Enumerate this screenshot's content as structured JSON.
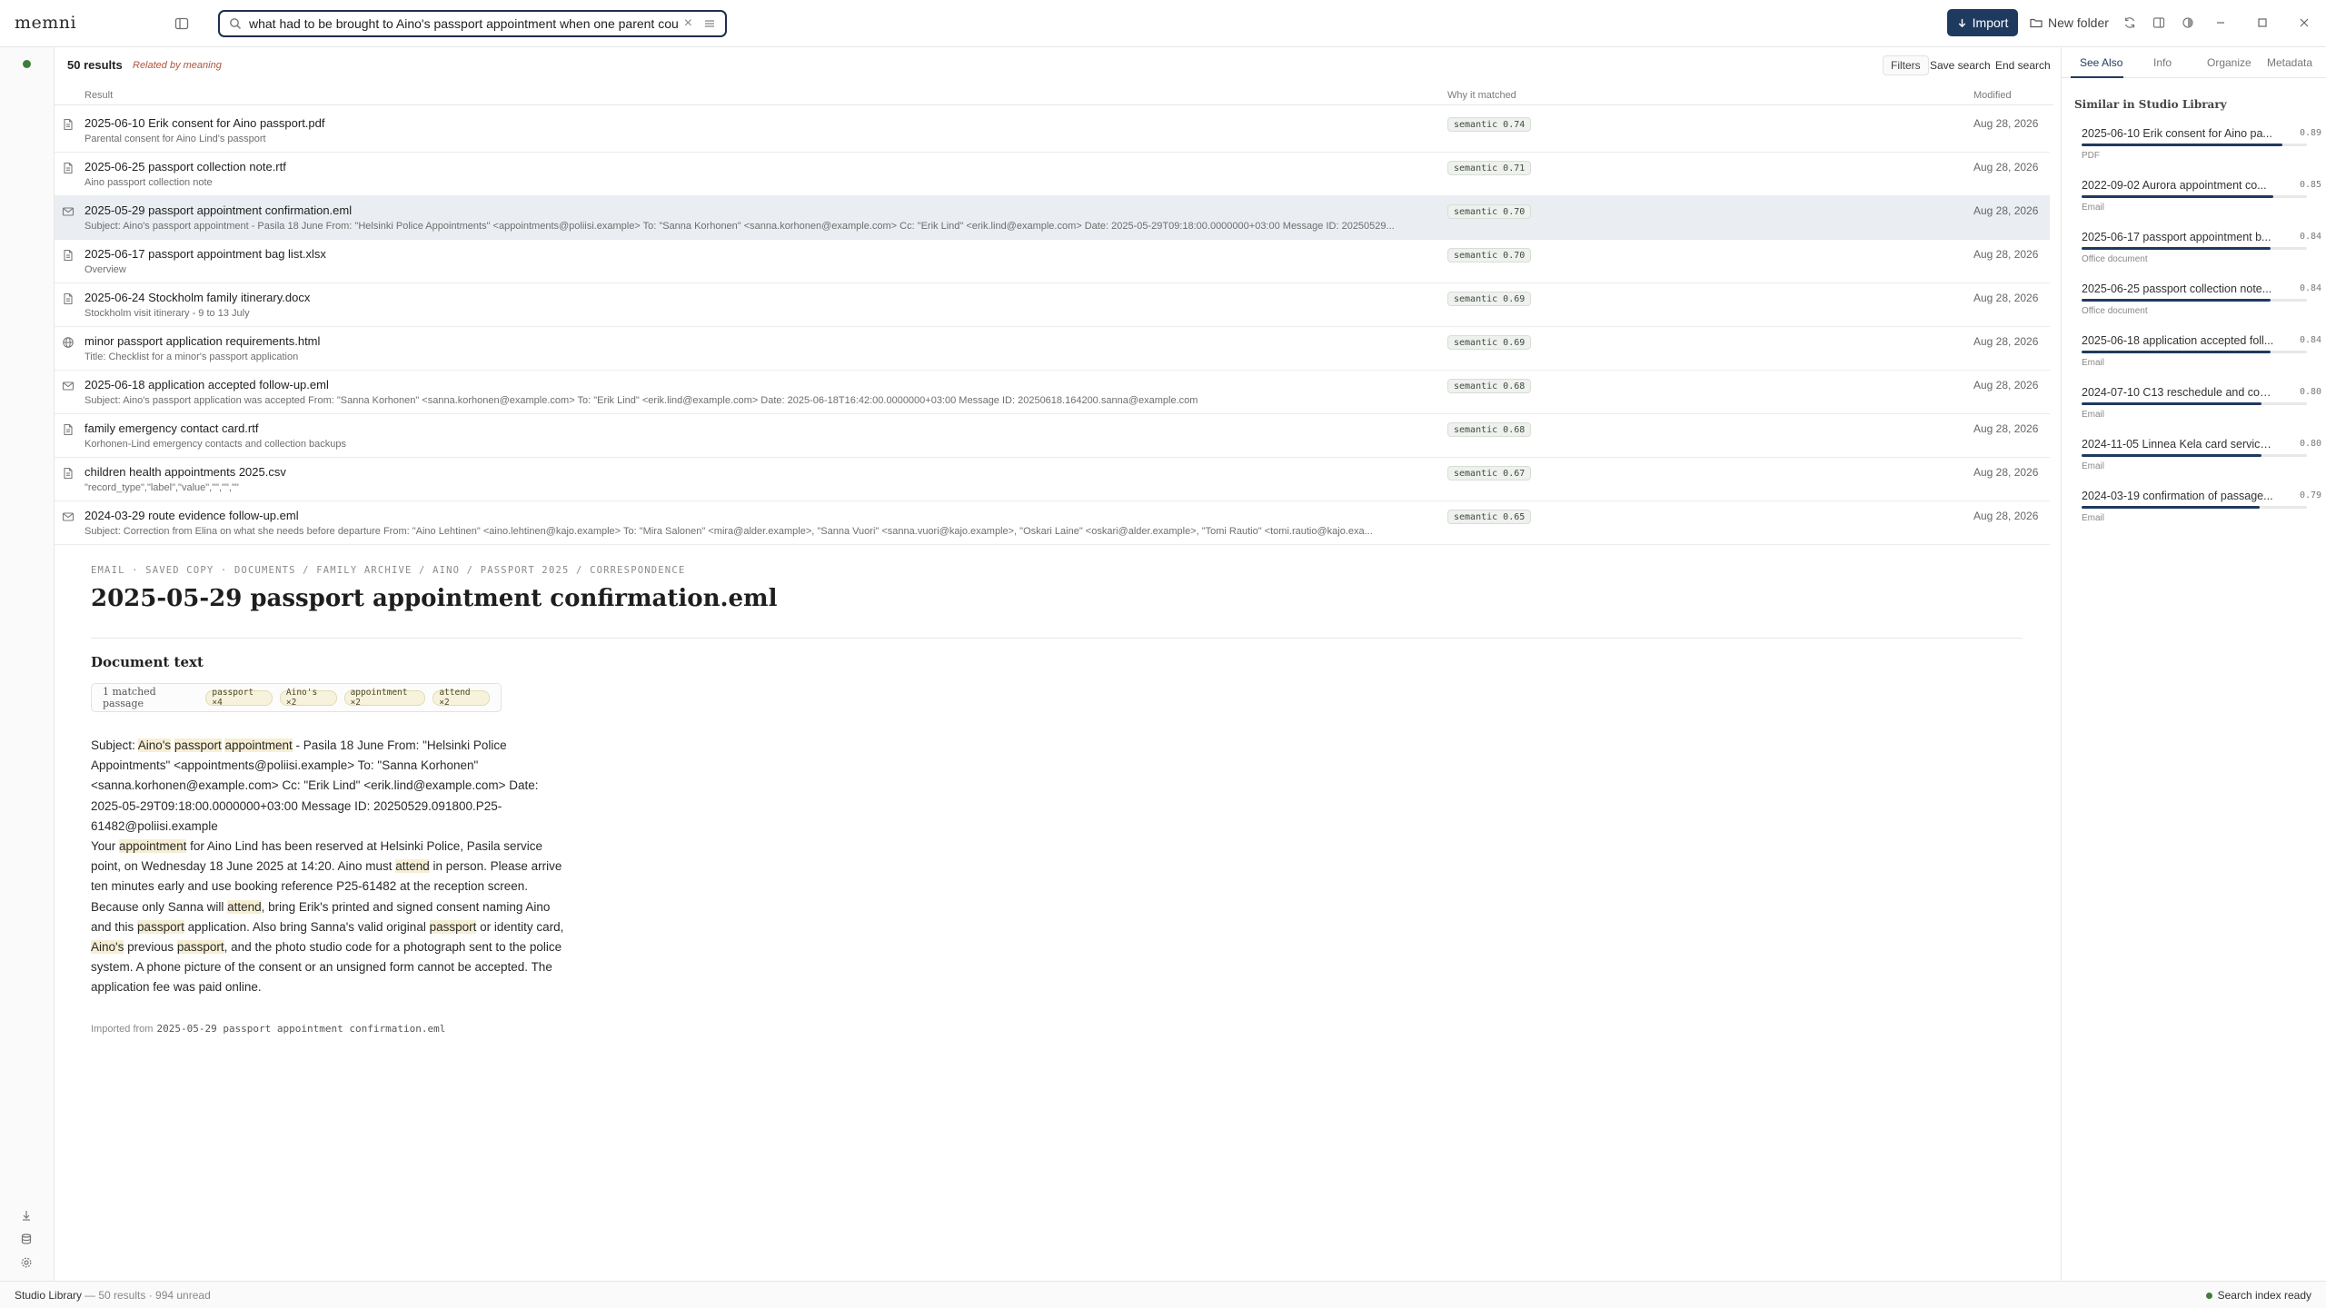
{
  "app": {
    "name": "memni"
  },
  "search": {
    "query": "what had to be brought to Aino's passport appointment when one parent could not attend",
    "placeholder": ""
  },
  "toolbar": {
    "import_label": "Import",
    "new_folder_label": "New folder"
  },
  "results": {
    "count_label": "50 results",
    "related_label": "Related by meaning",
    "filters_label": "Filters",
    "save_search_label": "Save search",
    "end_search_label": "End search",
    "columns": {
      "result": "Result",
      "why": "Why it matched",
      "modified": "Modified"
    },
    "rows": [
      {
        "icon": "document-icon",
        "title": "2025-06-10 Erik consent for Aino passport.pdf",
        "sub": "Parental consent for Aino Lind's passport",
        "badge": "semantic 0.74",
        "modified": "Aug 28, 2026"
      },
      {
        "icon": "document-icon",
        "title": "2025-06-25 passport collection note.rtf",
        "sub": "Aino passport collection note",
        "badge": "semantic 0.71",
        "modified": "Aug 28, 2026"
      },
      {
        "icon": "email-icon",
        "title": "2025-05-29 passport appointment confirmation.eml",
        "sub": "Subject: Aino's passport appointment - Pasila 18 June From: \"Helsinki Police Appointments\" <appointments@poliisi.example> To: \"Sanna Korhonen\" <sanna.korhonen@example.com> Cc: \"Erik Lind\" <erik.lind@example.com> Date: 2025-05-29T09:18:00.0000000+03:00 Message ID: 20250529...",
        "badge": "semantic 0.70",
        "modified": "Aug 28, 2026",
        "selected": true
      },
      {
        "icon": "document-icon",
        "title": "2025-06-17 passport appointment bag list.xlsx",
        "sub": "Overview",
        "badge": "semantic 0.70",
        "modified": "Aug 28, 2026"
      },
      {
        "icon": "document-icon",
        "title": "2025-06-24 Stockholm family itinerary.docx",
        "sub": "Stockholm visit itinerary - 9 to 13 July",
        "badge": "semantic 0.69",
        "modified": "Aug 28, 2026"
      },
      {
        "icon": "globe-icon",
        "title": "minor passport application requirements.html",
        "sub": "Title: Checklist for a minor's passport application",
        "badge": "semantic 0.69",
        "modified": "Aug 28, 2026"
      },
      {
        "icon": "email-icon",
        "title": "2025-06-18 application accepted follow-up.eml",
        "sub": "Subject: Aino's passport application was accepted From: \"Sanna Korhonen\" <sanna.korhonen@example.com> To: \"Erik Lind\" <erik.lind@example.com> Date: 2025-06-18T16:42:00.0000000+03:00 Message ID: 20250618.164200.sanna@example.com",
        "badge": "semantic 0.68",
        "modified": "Aug 28, 2026"
      },
      {
        "icon": "document-icon",
        "title": "family emergency contact card.rtf",
        "sub": "Korhonen-Lind emergency contacts and collection backups",
        "badge": "semantic 0.68",
        "modified": "Aug 28, 2026"
      },
      {
        "icon": "document-icon",
        "title": "children health appointments 2025.csv",
        "sub": "\"record_type\",\"label\",\"value\",\"\",\"\",\"\"",
        "badge": "semantic 0.67",
        "modified": "Aug 28, 2026"
      },
      {
        "icon": "email-icon",
        "title": "2024-03-29 route evidence follow-up.eml",
        "sub": "Subject: Correction from Elina on what she needs before departure From: \"Aino Lehtinen\" <aino.lehtinen@kajo.example> To: \"Mira Salonen\" <mira@alder.example>, \"Sanna Vuori\" <sanna.vuori@kajo.example>, \"Oskari Laine\" <oskari@alder.example>, \"Tomi Rautio\" <tomi.rautio@kajo.exa...",
        "badge": "semantic 0.65",
        "modified": "Aug 28, 2026"
      }
    ]
  },
  "preview": {
    "breadcrumb": "EMAIL · SAVED COPY · DOCUMENTS / FAMILY ARCHIVE / AINO / PASSPORT 2025 / CORRESPONDENCE",
    "title": "2025-05-29 passport appointment confirmation.eml",
    "doc_text_heading": "Document text",
    "matched_label": "1 matched passage",
    "chips": [
      "passport ×4",
      "Aino's ×2",
      "appointment ×2",
      "attend ×2"
    ],
    "body": {
      "p1": [
        {
          "t": "Subject: "
        },
        {
          "t": "Aino's",
          "h": true
        },
        {
          "t": " "
        },
        {
          "t": "passport",
          "h": true
        },
        {
          "t": " "
        },
        {
          "t": "appointment",
          "h": true
        },
        {
          "t": " - Pasila 18 June From: \"Helsinki Police Appointments\" <appointments@poliisi.example> To: \"Sanna Korhonen\" <sanna.korhonen@example.com> Cc: \"Erik Lind\" <erik.lind@example.com> Date: 2025-05-29T09:18:00.0000000+03:00 Message ID: 20250529.091800.P25-61482@poliisi.example"
        }
      ],
      "p2": [
        {
          "t": "Your "
        },
        {
          "t": "appointment",
          "h": true
        },
        {
          "t": " for Aino Lind has been reserved at Helsinki Police, Pasila service point, on Wednesday 18 June 2025 at 14:20. Aino must "
        },
        {
          "t": "attend",
          "h": true
        },
        {
          "t": " in person. Please arrive ten minutes early and use booking reference P25-61482 at the reception screen. Because only Sanna will "
        },
        {
          "t": "attend",
          "h": true
        },
        {
          "t": ", bring Erik's printed and signed consent naming Aino and this "
        },
        {
          "t": "passport",
          "h": true
        },
        {
          "t": " application. Also bring Sanna's valid original "
        },
        {
          "t": "passport",
          "h": true
        },
        {
          "t": " or identity card, "
        },
        {
          "t": "Aino's",
          "h": true
        },
        {
          "t": " previous "
        },
        {
          "t": "passport",
          "h": true
        },
        {
          "t": ", and the photo studio code for a photograph sent to the police system. A phone picture of the consent or an unsigned form cannot be accepted. The application fee was paid online."
        }
      ]
    },
    "imported_label": "Imported from",
    "imported_file": "2025-05-29 passport appointment confirmation.eml"
  },
  "panel": {
    "tabs": [
      "See Also",
      "Info",
      "Organize",
      "Metadata"
    ],
    "similar_heading": "Similar in Studio Library",
    "similar": [
      {
        "title": "2025-06-10 Erik consent for Aino pa...",
        "score": "0.89",
        "score_value": 0.89,
        "kind": "PDF"
      },
      {
        "title": "2022-09-02 Aurora appointment co...",
        "score": "0.85",
        "score_value": 0.85,
        "kind": "Email"
      },
      {
        "title": "2025-06-17 passport appointment b...",
        "score": "0.84",
        "score_value": 0.84,
        "kind": "Office document"
      },
      {
        "title": "2025-06-25 passport collection note...",
        "score": "0.84",
        "score_value": 0.84,
        "kind": "Office document"
      },
      {
        "title": "2025-06-18 application accepted foll...",
        "score": "0.84",
        "score_value": 0.84,
        "kind": "Email"
      },
      {
        "title": "2024-07-10 C13 reschedule and con...",
        "score": "0.80",
        "score_value": 0.8,
        "kind": "Email"
      },
      {
        "title": "2024-11-05 Linnea Kela card service ...",
        "score": "0.80",
        "score_value": 0.8,
        "kind": "Email"
      },
      {
        "title": "2024-03-19 confirmation of passage...",
        "score": "0.79",
        "score_value": 0.79,
        "kind": "Email"
      }
    ]
  },
  "status": {
    "library": "Studio Library",
    "meta": "— 50 results · 994 unread",
    "ready": "Search index ready"
  },
  "colors": {
    "accent": "#1f3a5f",
    "highlight": "#f7efd4",
    "ready": "#3f7d3a"
  }
}
